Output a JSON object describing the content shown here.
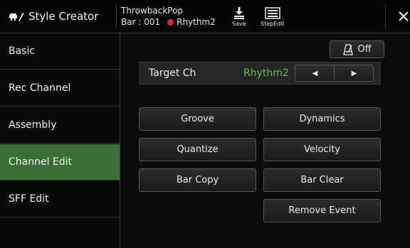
{
  "header": {
    "app_title": "Style Creator",
    "style_name": "ThrowbackPop",
    "bar_label": "Bar : 001",
    "rec_part": "Rhythm2",
    "save_label": "Save",
    "stepedit_label": "StepEdit",
    "rec_color": "#e0222a"
  },
  "sidebar": {
    "items": [
      {
        "label": "Basic"
      },
      {
        "label": "Rec Channel"
      },
      {
        "label": "Assembly"
      },
      {
        "label": "Channel Edit"
      },
      {
        "label": "SFF Edit"
      }
    ],
    "active_color": "#3b6e35"
  },
  "main": {
    "metronome_state": "Off",
    "target": {
      "label": "Target Ch",
      "value": "Rhythm2",
      "value_color": "#5ec24a"
    },
    "buttons": {
      "groove": "Groove",
      "dynamics": "Dynamics",
      "quantize": "Quantize",
      "velocity": "Velocity",
      "bar_copy": "Bar Copy",
      "bar_clear": "Bar Clear",
      "remove_event": "Remove Event"
    }
  }
}
